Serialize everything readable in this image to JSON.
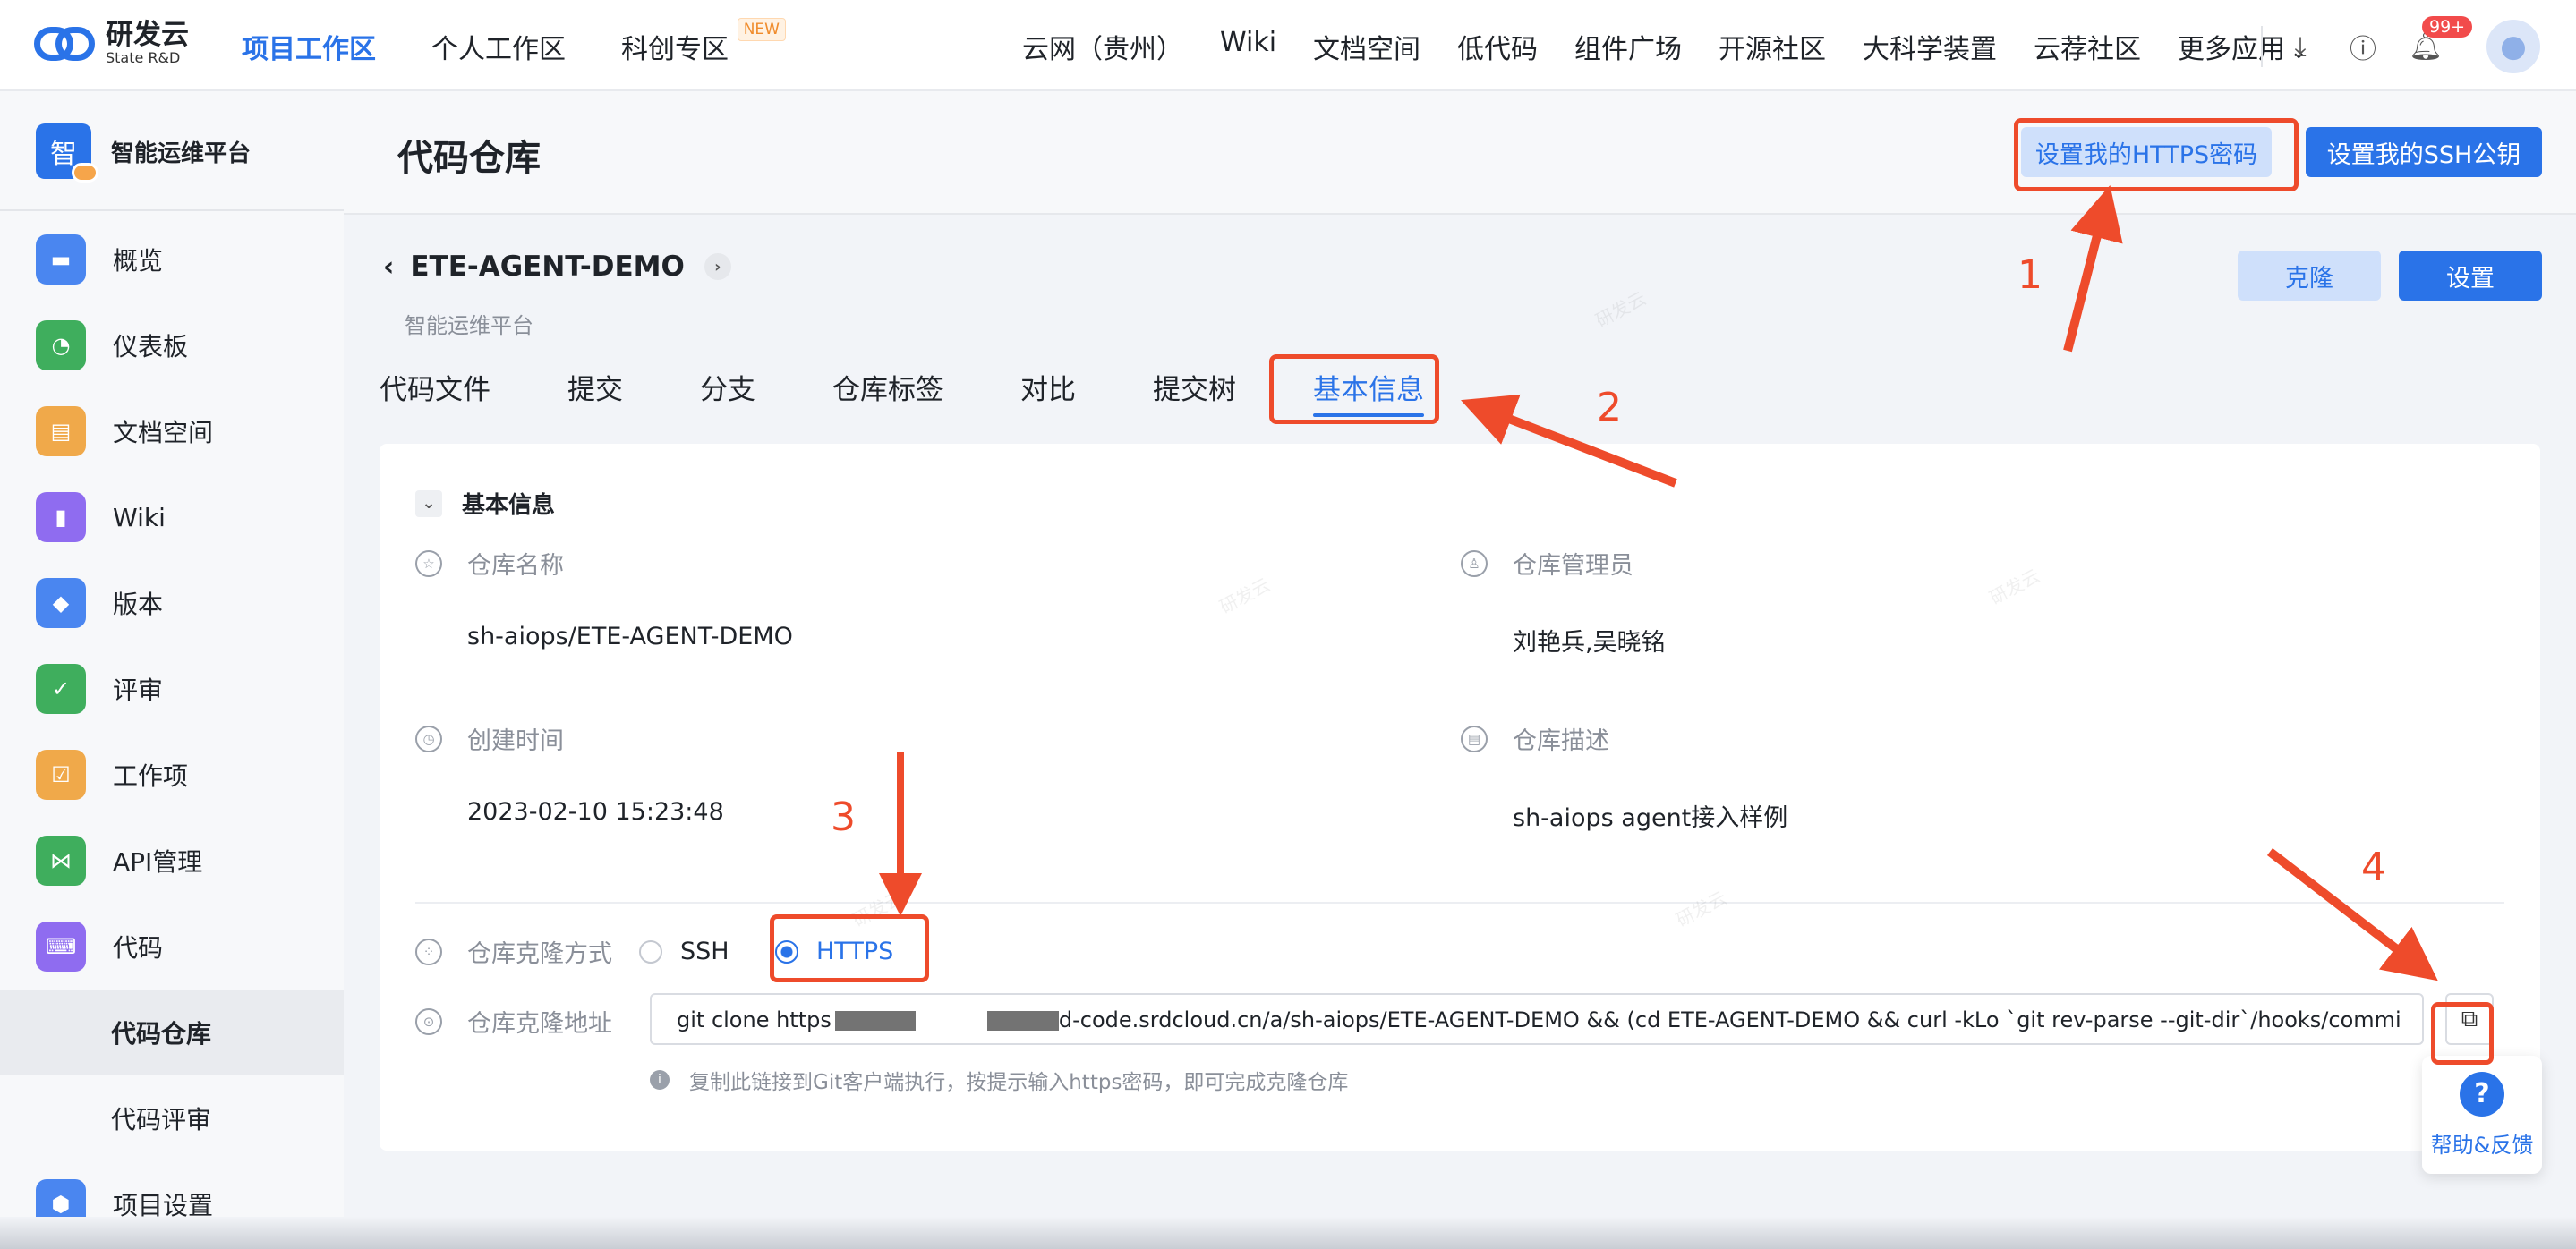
{
  "top": {
    "logo_cn": "研发云",
    "logo_en": "State R&D",
    "nav": [
      "项目工作区",
      "个人工作区",
      "科创专区"
    ],
    "new_badge": "NEW",
    "links": [
      "云网（贵州）",
      "Wiki",
      "文档空间",
      "低代码",
      "组件广场",
      "开源社区",
      "大科学装置",
      "云荐社区",
      "更多应用"
    ],
    "notif_count": "99+"
  },
  "sidebar": {
    "platform_logo": "智",
    "platform_name": "智能运维平台",
    "items": [
      {
        "label": "概览",
        "icon": "overview-icon",
        "color": "#4a86f0"
      },
      {
        "label": "仪表板",
        "icon": "dashboard-icon",
        "color": "#3fae5d"
      },
      {
        "label": "文档空间",
        "icon": "doc-icon",
        "color": "#f0a94a"
      },
      {
        "label": "Wiki",
        "icon": "wiki-icon",
        "color": "#8f6cf0"
      },
      {
        "label": "版本",
        "icon": "version-icon",
        "color": "#4a86f0"
      },
      {
        "label": "评审",
        "icon": "review-icon",
        "color": "#3fae5d"
      },
      {
        "label": "工作项",
        "icon": "workitem-icon",
        "color": "#f0a94a"
      },
      {
        "label": "API管理",
        "icon": "api-icon",
        "color": "#3fae5d"
      },
      {
        "label": "代码",
        "icon": "code-icon",
        "color": "#8f6cf0"
      }
    ],
    "sub_items": [
      "代码仓库",
      "代码评审"
    ],
    "bottom_item": {
      "label": "项目设置",
      "icon": "project-settings-icon",
      "color": "#4a86f0"
    }
  },
  "header": {
    "title": "代码仓库",
    "btn_https": "设置我的HTTPS密码",
    "btn_ssh": "设置我的SSH公钥"
  },
  "repo": {
    "name": "ETE-AGENT-DEMO",
    "subtitle": "智能运维平台",
    "btn_clone": "克隆",
    "btn_settings": "设置",
    "tabs": [
      "代码文件",
      "提交",
      "分支",
      "仓库标签",
      "对比",
      "提交树",
      "基本信息"
    ],
    "active_tab": "基本信息"
  },
  "info": {
    "section_title": "基本信息",
    "repo_name_label": "仓库名称",
    "repo_name_value": "sh-aiops/ETE-AGENT-DEMO",
    "admin_label": "仓库管理员",
    "admin_value": "刘艳兵,吴晓铭",
    "created_label": "创建时间",
    "created_value": "2023-02-10 15:23:48",
    "desc_label": "仓库描述",
    "desc_value": "sh-aiops agent接入样例",
    "clone_method_label": "仓库克隆方式",
    "clone_options": [
      "SSH",
      "HTTPS"
    ],
    "clone_selected": "HTTPS",
    "clone_url_label": "仓库克隆地址",
    "clone_url_prefix": "git clone https",
    "clone_url_suffix": "d-code.srdcloud.cn/a/sh-aiops/ETE-AGENT-DEMO && (cd ETE-AGENT-DEMO && curl -kLo `git rev-parse --git-dir`/hooks/commi",
    "hint": "复制此链接到Git客户端执行，按提示输入https密码，即可完成克隆仓库"
  },
  "help": {
    "label": "帮助&反馈"
  },
  "annotations": {
    "color": "#ee4b2b",
    "numbers": [
      "1",
      "2",
      "3",
      "4"
    ]
  }
}
